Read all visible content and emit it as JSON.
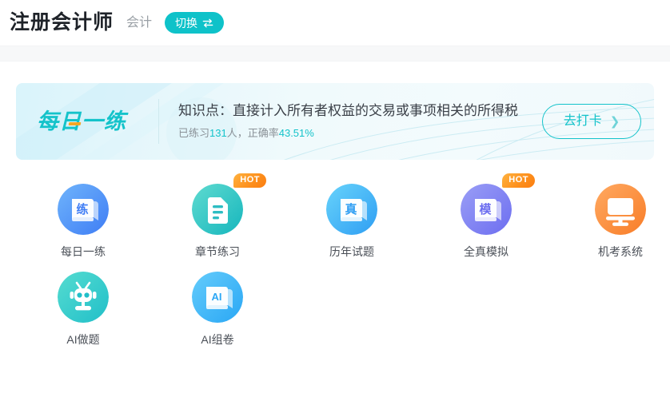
{
  "header": {
    "title": "注册会计师",
    "subject": "会计",
    "switch_label": "切换",
    "switch_icon": "swap-arrows-icon"
  },
  "banner": {
    "logo_text": "每日一练",
    "knowledge_point": "知识点：直接计入所有者权益的交易或事项相关的所得税",
    "stats_prefix": "已练习",
    "stats_count": "131",
    "stats_middle": "人，正确率",
    "stats_accuracy": "43.51%",
    "button_label": "去打卡",
    "button_chevron": "❯",
    "accent_color": "#14c3ca",
    "highlight_color": "#f5a623"
  },
  "entries": [
    {
      "label": "每日一练",
      "icon": "book-practice-icon",
      "glyph": "练",
      "badge": "",
      "c1": "#6fb4fb",
      "c2": "#3f7df5"
    },
    {
      "label": "章节练习",
      "icon": "document-lines-icon",
      "glyph": "",
      "badge": "HOT",
      "c1": "#5fdbd0",
      "c2": "#16b6bd"
    },
    {
      "label": "历年试题",
      "icon": "book-real-exam-icon",
      "glyph": "真",
      "badge": "",
      "c1": "#67d3fb",
      "c2": "#2f9ef3"
    },
    {
      "label": "全真模拟",
      "icon": "book-mock-exam-icon",
      "glyph": "模",
      "badge": "HOT",
      "c1": "#9a9ef6",
      "c2": "#6d6ef0"
    },
    {
      "label": "机考系统",
      "icon": "monitor-icon",
      "glyph": "",
      "badge": "",
      "c1": "#ffa961",
      "c2": "#f87d28"
    },
    {
      "label": "AI做题",
      "icon": "robot-icon",
      "glyph": "",
      "badge": "",
      "c1": "#55dcd0",
      "c2": "#21bfc9"
    },
    {
      "label": "AI组卷",
      "icon": "ai-paper-icon",
      "glyph": "AI",
      "badge": "",
      "c1": "#64ccfb",
      "c2": "#2aa7f5"
    }
  ]
}
